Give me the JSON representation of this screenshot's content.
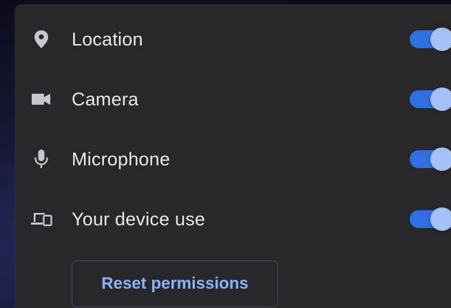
{
  "permissions": {
    "items": [
      {
        "label": "Location",
        "icon": "location-pin-icon",
        "enabled": true
      },
      {
        "label": "Camera",
        "icon": "camera-icon",
        "enabled": true
      },
      {
        "label": "Microphone",
        "icon": "microphone-icon",
        "enabled": true
      },
      {
        "label": "Your device use",
        "icon": "devices-icon",
        "enabled": true
      }
    ],
    "reset_label": "Reset permissions"
  },
  "colors": {
    "panel_bg": "#28282c",
    "text": "#e8e8ea",
    "toggle_track": "#2f6fe0",
    "toggle_knob": "#a4c0f4",
    "accent_link": "#8ab4f8",
    "icon": "#c4c7cc"
  }
}
